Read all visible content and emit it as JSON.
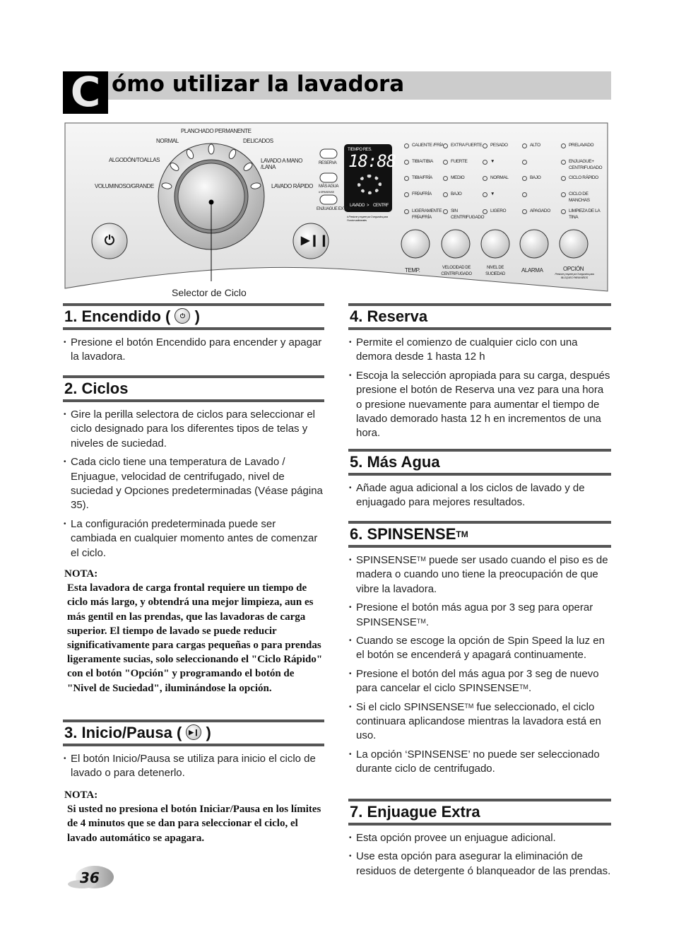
{
  "header": {
    "initial": "C",
    "title": "ómo utilizar la lavadora"
  },
  "panel": {
    "dial_programs": [
      "PLANCHADO PERMANENTE",
      "NORMAL",
      "DELICADOS",
      "ALGODÓN/TOALLAS",
      "LAVADO A MANO /LANA",
      "VOLUMINOSO/GRANDE",
      "LAVADO RÁPIDO"
    ],
    "side_buttons": [
      "RESERVA",
      "MÁS AGUA",
      "ENJUAGUE EXTRA"
    ],
    "mas_agua_hint": "# SPINSENSE",
    "display": {
      "label_left": "TIEMPO RES.",
      "digits": "18:88",
      "stage_left": "LAVADO",
      "stage_arrow": ">",
      "stage_right": "CENTRF",
      "note": "# Presione y espere por 3 segundos para Funcion adicionales"
    },
    "indicator_columns": [
      {
        "items": [
          "CALIENTE /FRÍA",
          "TIBIA/TIBIA",
          "TIBIA/FRÍA",
          "FRÍA/FRÍA",
          "LIGERAMENTE FRÍA/FRÍA"
        ]
      },
      {
        "items": [
          "EXTRA FUERTE",
          "FUERTE",
          "MEDIO",
          "BAJO",
          "SIN CENTRIFUGADO"
        ]
      },
      {
        "items": [
          "PESADO",
          "▼",
          "NORMAL",
          "▼",
          "LIGERO"
        ]
      },
      {
        "items": [
          "ALTO",
          "",
          "BAJO",
          "",
          "APAGADO"
        ]
      },
      {
        "items": [
          "PRELAVADO",
          "ENJUAGUE+ CENTRIFUGADO",
          "CICLO RÁPIDO",
          "CICLO DE MANCHAS",
          "LIMPIEZA DE LA TINA"
        ]
      }
    ],
    "option_buttons": [
      "TEMP.",
      "VELOCIDAD DE CENTRIFUGADO",
      "NIVEL DE SUCIEDAD",
      "ALARMA",
      "OPCIÓN"
    ],
    "opcion_hint": "Presione y espere por 3 segundos para BLOQUEO PARA NIÑOS",
    "selector_caption": "Selector de Ciclo"
  },
  "sections": {
    "encendido": {
      "title_pre": "1. Encendido (",
      "title_post": ")",
      "bullets": [
        "Presione el botón Encendido para encender y apagar la lavadora."
      ]
    },
    "ciclos": {
      "title": "2. Ciclos",
      "bullets": [
        "Gire la perilla selectora de ciclos para seleccionar el ciclo designado para los diferentes tipos de telas y niveles de suciedad.",
        "Cada ciclo tiene una temperatura de Lavado / Enjuague, velocidad de centrifugado, nivel de suciedad y Opciones predeterminadas (Véase página 35).",
        "La configuración predeterminada puede ser cambiada en cualquier momento antes de comenzar el ciclo."
      ],
      "nota_label": "NOTA:",
      "nota": "Esta lavadora de carga frontal requiere un tiempo de ciclo más largo, y obtendrá una mejor limpieza, aun es más gentil en las prendas, que las lavadoras de carga superior. El tiempo de lavado se puede reducir significativamente para cargas pequeñas o para prendas ligeramente sucias, solo seleccionando el \"Ciclo Rápido\" con el botón \"Opción\" y programando el botón de \"Nivel de Suciedad\", iluminándose la opción."
    },
    "inicio": {
      "title_pre": "3. Inicio/Pausa (",
      "title_post": ")",
      "bullets": [
        "El botón Inicio/Pausa se utiliza para inicio el ciclo de lavado o para detenerlo."
      ],
      "nota_label": "NOTA:",
      "nota": "Si usted no presiona el botón Iniciar/Pausa en los límites de 4 minutos que se dan para seleccionar el ciclo, el lavado automático se apagara."
    },
    "reserva": {
      "title": "4. Reserva",
      "bullets": [
        "Permite el comienzo de cualquier ciclo con una demora desde 1 hasta 12 h",
        "Escoja la selección apropiada para su carga, después presione el botón de Reserva una vez para una hora o presione nuevamente para aumentar el tiempo de lavado demorado hasta 12 h en incrementos de una hora."
      ]
    },
    "mas_agua": {
      "title": "5. Más Agua",
      "bullets": [
        "Añade agua adicional a los ciclos de lavado y de enjuagado para mejores resultados."
      ]
    },
    "spinsense": {
      "title": "6. SPINSENSE",
      "tm": "TM",
      "bullets": [
        {
          "a": "SPINSENSE",
          "b": " puede ser usado cuando el piso es de madera o cuando uno tiene la preocupación de que vibre la lavadora."
        },
        {
          "a": "Presione el botón más agua por 3 seg para operar SPINSENSE",
          "b": "."
        },
        {
          "a": "Cuando se escoge la opción de Spin Speed la luz en el botón se encenderá y apagará continuamente.",
          "b": ""
        },
        {
          "a": "Presione el botón del más agua por 3 seg de nuevo para cancelar el ciclo SPINSENSE",
          "b": "."
        },
        {
          "a": "Si el ciclo SPINSENSE",
          "b": " fue seleccionado, el ciclo continuara aplicandose mientras la lavadora está en uso."
        },
        {
          "a": "La opción ‘SPINSENSE’ no puede ser seleccionado durante ciclo de centrifugado.",
          "b": ""
        }
      ]
    },
    "enjuague": {
      "title": "7. Enjuague Extra",
      "bullets": [
        "Esta opción provee un enjuague adicional.",
        "Use esta opción para asegurar la eliminación de residuos de detergente ó blanqueador de las prendas."
      ]
    }
  },
  "page_number": "36"
}
